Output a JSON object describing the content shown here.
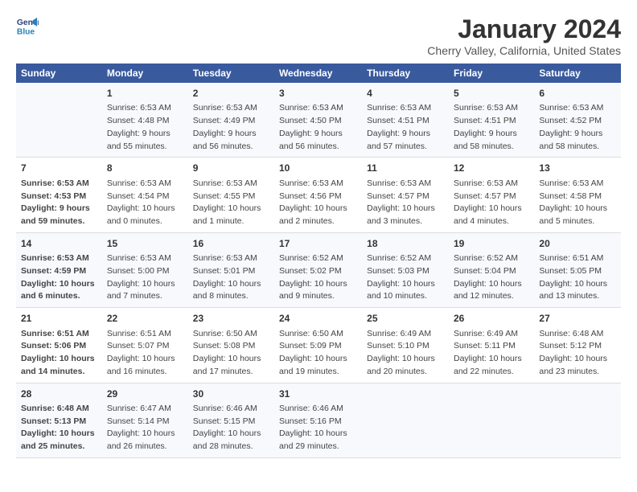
{
  "logo": {
    "line1": "General",
    "line2": "Blue"
  },
  "title": "January 2024",
  "subtitle": "Cherry Valley, California, United States",
  "headers": [
    "Sunday",
    "Monday",
    "Tuesday",
    "Wednesday",
    "Thursday",
    "Friday",
    "Saturday"
  ],
  "weeks": [
    [
      {
        "num": "",
        "info": ""
      },
      {
        "num": "1",
        "info": "Sunrise: 6:53 AM\nSunset: 4:48 PM\nDaylight: 9 hours\nand 55 minutes."
      },
      {
        "num": "2",
        "info": "Sunrise: 6:53 AM\nSunset: 4:49 PM\nDaylight: 9 hours\nand 56 minutes."
      },
      {
        "num": "3",
        "info": "Sunrise: 6:53 AM\nSunset: 4:50 PM\nDaylight: 9 hours\nand 56 minutes."
      },
      {
        "num": "4",
        "info": "Sunrise: 6:53 AM\nSunset: 4:51 PM\nDaylight: 9 hours\nand 57 minutes."
      },
      {
        "num": "5",
        "info": "Sunrise: 6:53 AM\nSunset: 4:51 PM\nDaylight: 9 hours\nand 58 minutes."
      },
      {
        "num": "6",
        "info": "Sunrise: 6:53 AM\nSunset: 4:52 PM\nDaylight: 9 hours\nand 58 minutes."
      }
    ],
    [
      {
        "num": "7",
        "info": "Sunrise: 6:53 AM\nSunset: 4:53 PM\nDaylight: 9 hours\nand 59 minutes."
      },
      {
        "num": "8",
        "info": "Sunrise: 6:53 AM\nSunset: 4:54 PM\nDaylight: 10 hours\nand 0 minutes."
      },
      {
        "num": "9",
        "info": "Sunrise: 6:53 AM\nSunset: 4:55 PM\nDaylight: 10 hours\nand 1 minute."
      },
      {
        "num": "10",
        "info": "Sunrise: 6:53 AM\nSunset: 4:56 PM\nDaylight: 10 hours\nand 2 minutes."
      },
      {
        "num": "11",
        "info": "Sunrise: 6:53 AM\nSunset: 4:57 PM\nDaylight: 10 hours\nand 3 minutes."
      },
      {
        "num": "12",
        "info": "Sunrise: 6:53 AM\nSunset: 4:57 PM\nDaylight: 10 hours\nand 4 minutes."
      },
      {
        "num": "13",
        "info": "Sunrise: 6:53 AM\nSunset: 4:58 PM\nDaylight: 10 hours\nand 5 minutes."
      }
    ],
    [
      {
        "num": "14",
        "info": "Sunrise: 6:53 AM\nSunset: 4:59 PM\nDaylight: 10 hours\nand 6 minutes."
      },
      {
        "num": "15",
        "info": "Sunrise: 6:53 AM\nSunset: 5:00 PM\nDaylight: 10 hours\nand 7 minutes."
      },
      {
        "num": "16",
        "info": "Sunrise: 6:53 AM\nSunset: 5:01 PM\nDaylight: 10 hours\nand 8 minutes."
      },
      {
        "num": "17",
        "info": "Sunrise: 6:52 AM\nSunset: 5:02 PM\nDaylight: 10 hours\nand 9 minutes."
      },
      {
        "num": "18",
        "info": "Sunrise: 6:52 AM\nSunset: 5:03 PM\nDaylight: 10 hours\nand 10 minutes."
      },
      {
        "num": "19",
        "info": "Sunrise: 6:52 AM\nSunset: 5:04 PM\nDaylight: 10 hours\nand 12 minutes."
      },
      {
        "num": "20",
        "info": "Sunrise: 6:51 AM\nSunset: 5:05 PM\nDaylight: 10 hours\nand 13 minutes."
      }
    ],
    [
      {
        "num": "21",
        "info": "Sunrise: 6:51 AM\nSunset: 5:06 PM\nDaylight: 10 hours\nand 14 minutes."
      },
      {
        "num": "22",
        "info": "Sunrise: 6:51 AM\nSunset: 5:07 PM\nDaylight: 10 hours\nand 16 minutes."
      },
      {
        "num": "23",
        "info": "Sunrise: 6:50 AM\nSunset: 5:08 PM\nDaylight: 10 hours\nand 17 minutes."
      },
      {
        "num": "24",
        "info": "Sunrise: 6:50 AM\nSunset: 5:09 PM\nDaylight: 10 hours\nand 19 minutes."
      },
      {
        "num": "25",
        "info": "Sunrise: 6:49 AM\nSunset: 5:10 PM\nDaylight: 10 hours\nand 20 minutes."
      },
      {
        "num": "26",
        "info": "Sunrise: 6:49 AM\nSunset: 5:11 PM\nDaylight: 10 hours\nand 22 minutes."
      },
      {
        "num": "27",
        "info": "Sunrise: 6:48 AM\nSunset: 5:12 PM\nDaylight: 10 hours\nand 23 minutes."
      }
    ],
    [
      {
        "num": "28",
        "info": "Sunrise: 6:48 AM\nSunset: 5:13 PM\nDaylight: 10 hours\nand 25 minutes."
      },
      {
        "num": "29",
        "info": "Sunrise: 6:47 AM\nSunset: 5:14 PM\nDaylight: 10 hours\nand 26 minutes."
      },
      {
        "num": "30",
        "info": "Sunrise: 6:46 AM\nSunset: 5:15 PM\nDaylight: 10 hours\nand 28 minutes."
      },
      {
        "num": "31",
        "info": "Sunrise: 6:46 AM\nSunset: 5:16 PM\nDaylight: 10 hours\nand 29 minutes."
      },
      {
        "num": "",
        "info": ""
      },
      {
        "num": "",
        "info": ""
      },
      {
        "num": "",
        "info": ""
      }
    ]
  ]
}
